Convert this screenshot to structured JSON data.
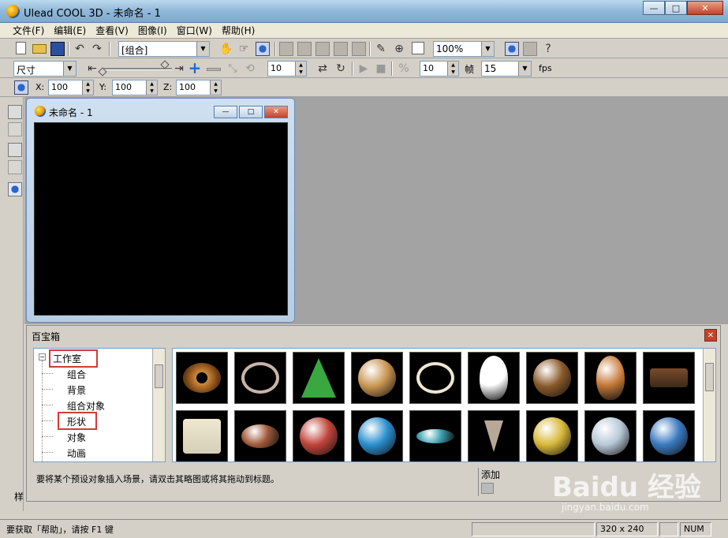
{
  "window": {
    "title": "Ulead COOL 3D - 未命名 - 1",
    "minimize": "—",
    "maximize": "□",
    "close": "✕"
  },
  "menu": [
    "文件(F)",
    "编辑(E)",
    "查看(V)",
    "图像(I)",
    "窗口(W)",
    "帮助(H)"
  ],
  "toolbar1": {
    "group_combo": "[组合]",
    "zoom_combo": "100%"
  },
  "toolbar2": {
    "size_combo": "尺寸",
    "value1": "10",
    "value2": "10",
    "frames_label": "帧",
    "fps_value": "15",
    "fps_label": "fps"
  },
  "toolbar3": {
    "x_label": "X:",
    "x_value": "100",
    "y_label": "Y:",
    "y_value": "100",
    "z_label": "Z:",
    "z_value": "100"
  },
  "doc_window": {
    "title": "未命名 - 1"
  },
  "palette": {
    "title": "百宝箱",
    "close": "✕",
    "tree": {
      "root": "工作室",
      "expand": "−",
      "children": [
        "组合",
        "背景",
        "组合对象",
        "形状",
        "对象",
        "动画"
      ]
    },
    "thumbnails": [
      {
        "name": "donut",
        "color": "#d08a3a"
      },
      {
        "name": "ring",
        "color": "#c9b4a8"
      },
      {
        "name": "cone",
        "color": "#3aa840"
      },
      {
        "name": "bun",
        "color": "#c99552"
      },
      {
        "name": "pearl-necklace",
        "color": "#efe6d0"
      },
      {
        "name": "snowman",
        "color": "#ffffff"
      },
      {
        "name": "bear",
        "color": "#8a5a2a"
      },
      {
        "name": "gingerbread",
        "color": "#c67a3a"
      },
      {
        "name": "chocolate",
        "color": "#7a4a2a"
      },
      {
        "name": "esc-key",
        "color": "#d6cfb8"
      },
      {
        "name": "football",
        "color": "#a05a3a"
      },
      {
        "name": "basketball",
        "color": "#c0443a"
      },
      {
        "name": "beach-ball",
        "color": "#2a8fd0"
      },
      {
        "name": "spinning-top",
        "color": "#3aa0b0"
      },
      {
        "name": "drill",
        "color": "#b8a898"
      },
      {
        "name": "pyramid-face",
        "color": "#d8b83a"
      },
      {
        "name": "chrome-sphere",
        "color": "#b8c8d8"
      },
      {
        "name": "earth",
        "color": "#3a7ac0"
      }
    ],
    "hint": "要将某个预设对象插入场景，请双击其略图或将其拖动到标题。",
    "add_label": "添加"
  },
  "left_label": "样",
  "status": {
    "help_text": "要获取「帮助」，请按 F1 键",
    "size": "320 x 240",
    "num": "NUM"
  },
  "watermark": {
    "main": "Baidu 经验",
    "sub": "jingyan.baidu.com"
  }
}
